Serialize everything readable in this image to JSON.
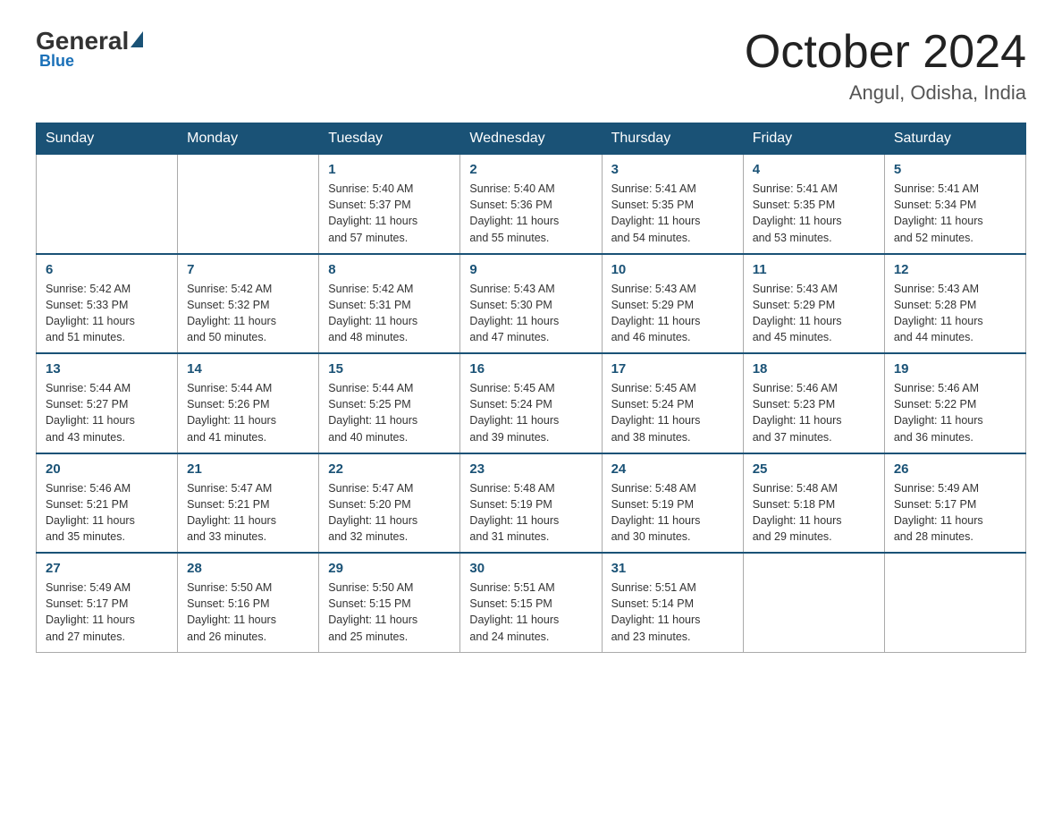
{
  "header": {
    "logo_general": "General",
    "logo_blue": "Blue",
    "month_title": "October 2024",
    "location": "Angul, Odisha, India"
  },
  "weekdays": [
    "Sunday",
    "Monday",
    "Tuesday",
    "Wednesday",
    "Thursday",
    "Friday",
    "Saturday"
  ],
  "weeks": [
    [
      {
        "day": "",
        "info": ""
      },
      {
        "day": "",
        "info": ""
      },
      {
        "day": "1",
        "info": "Sunrise: 5:40 AM\nSunset: 5:37 PM\nDaylight: 11 hours\nand 57 minutes."
      },
      {
        "day": "2",
        "info": "Sunrise: 5:40 AM\nSunset: 5:36 PM\nDaylight: 11 hours\nand 55 minutes."
      },
      {
        "day": "3",
        "info": "Sunrise: 5:41 AM\nSunset: 5:35 PM\nDaylight: 11 hours\nand 54 minutes."
      },
      {
        "day": "4",
        "info": "Sunrise: 5:41 AM\nSunset: 5:35 PM\nDaylight: 11 hours\nand 53 minutes."
      },
      {
        "day": "5",
        "info": "Sunrise: 5:41 AM\nSunset: 5:34 PM\nDaylight: 11 hours\nand 52 minutes."
      }
    ],
    [
      {
        "day": "6",
        "info": "Sunrise: 5:42 AM\nSunset: 5:33 PM\nDaylight: 11 hours\nand 51 minutes."
      },
      {
        "day": "7",
        "info": "Sunrise: 5:42 AM\nSunset: 5:32 PM\nDaylight: 11 hours\nand 50 minutes."
      },
      {
        "day": "8",
        "info": "Sunrise: 5:42 AM\nSunset: 5:31 PM\nDaylight: 11 hours\nand 48 minutes."
      },
      {
        "day": "9",
        "info": "Sunrise: 5:43 AM\nSunset: 5:30 PM\nDaylight: 11 hours\nand 47 minutes."
      },
      {
        "day": "10",
        "info": "Sunrise: 5:43 AM\nSunset: 5:29 PM\nDaylight: 11 hours\nand 46 minutes."
      },
      {
        "day": "11",
        "info": "Sunrise: 5:43 AM\nSunset: 5:29 PM\nDaylight: 11 hours\nand 45 minutes."
      },
      {
        "day": "12",
        "info": "Sunrise: 5:43 AM\nSunset: 5:28 PM\nDaylight: 11 hours\nand 44 minutes."
      }
    ],
    [
      {
        "day": "13",
        "info": "Sunrise: 5:44 AM\nSunset: 5:27 PM\nDaylight: 11 hours\nand 43 minutes."
      },
      {
        "day": "14",
        "info": "Sunrise: 5:44 AM\nSunset: 5:26 PM\nDaylight: 11 hours\nand 41 minutes."
      },
      {
        "day": "15",
        "info": "Sunrise: 5:44 AM\nSunset: 5:25 PM\nDaylight: 11 hours\nand 40 minutes."
      },
      {
        "day": "16",
        "info": "Sunrise: 5:45 AM\nSunset: 5:24 PM\nDaylight: 11 hours\nand 39 minutes."
      },
      {
        "day": "17",
        "info": "Sunrise: 5:45 AM\nSunset: 5:24 PM\nDaylight: 11 hours\nand 38 minutes."
      },
      {
        "day": "18",
        "info": "Sunrise: 5:46 AM\nSunset: 5:23 PM\nDaylight: 11 hours\nand 37 minutes."
      },
      {
        "day": "19",
        "info": "Sunrise: 5:46 AM\nSunset: 5:22 PM\nDaylight: 11 hours\nand 36 minutes."
      }
    ],
    [
      {
        "day": "20",
        "info": "Sunrise: 5:46 AM\nSunset: 5:21 PM\nDaylight: 11 hours\nand 35 minutes."
      },
      {
        "day": "21",
        "info": "Sunrise: 5:47 AM\nSunset: 5:21 PM\nDaylight: 11 hours\nand 33 minutes."
      },
      {
        "day": "22",
        "info": "Sunrise: 5:47 AM\nSunset: 5:20 PM\nDaylight: 11 hours\nand 32 minutes."
      },
      {
        "day": "23",
        "info": "Sunrise: 5:48 AM\nSunset: 5:19 PM\nDaylight: 11 hours\nand 31 minutes."
      },
      {
        "day": "24",
        "info": "Sunrise: 5:48 AM\nSunset: 5:19 PM\nDaylight: 11 hours\nand 30 minutes."
      },
      {
        "day": "25",
        "info": "Sunrise: 5:48 AM\nSunset: 5:18 PM\nDaylight: 11 hours\nand 29 minutes."
      },
      {
        "day": "26",
        "info": "Sunrise: 5:49 AM\nSunset: 5:17 PM\nDaylight: 11 hours\nand 28 minutes."
      }
    ],
    [
      {
        "day": "27",
        "info": "Sunrise: 5:49 AM\nSunset: 5:17 PM\nDaylight: 11 hours\nand 27 minutes."
      },
      {
        "day": "28",
        "info": "Sunrise: 5:50 AM\nSunset: 5:16 PM\nDaylight: 11 hours\nand 26 minutes."
      },
      {
        "day": "29",
        "info": "Sunrise: 5:50 AM\nSunset: 5:15 PM\nDaylight: 11 hours\nand 25 minutes."
      },
      {
        "day": "30",
        "info": "Sunrise: 5:51 AM\nSunset: 5:15 PM\nDaylight: 11 hours\nand 24 minutes."
      },
      {
        "day": "31",
        "info": "Sunrise: 5:51 AM\nSunset: 5:14 PM\nDaylight: 11 hours\nand 23 minutes."
      },
      {
        "day": "",
        "info": ""
      },
      {
        "day": "",
        "info": ""
      }
    ]
  ]
}
